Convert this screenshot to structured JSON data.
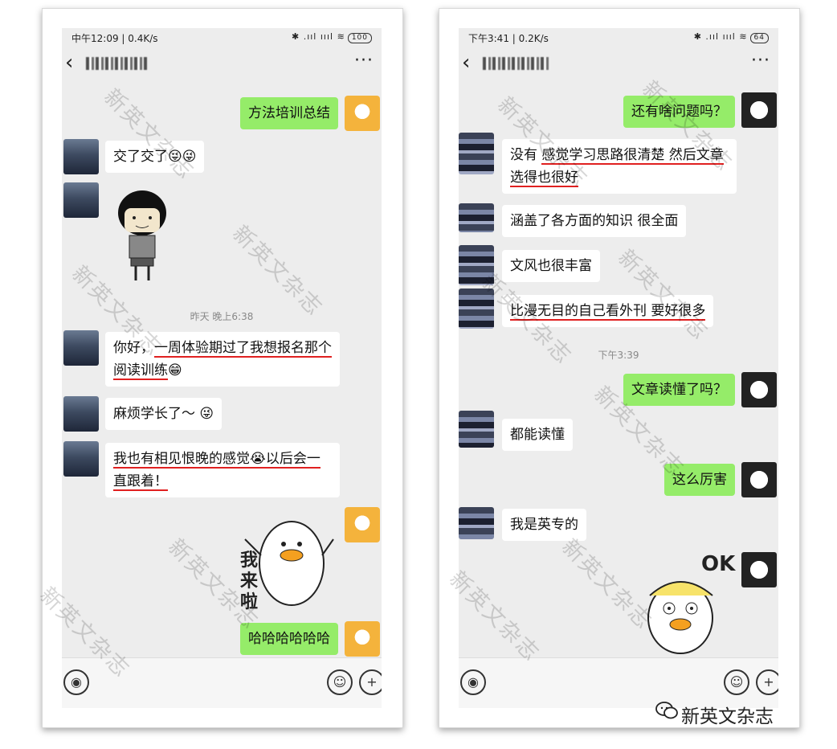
{
  "left_phone": {
    "status_time": "中午12:09 | 0.4K/s",
    "status_icons": "✱ .ııl ıııl ≋",
    "battery": "100",
    "messages": [
      {
        "side": "out",
        "text": "方法培训总结"
      },
      {
        "side": "in",
        "text": "交了交了😜😜"
      },
      {
        "side": "in",
        "sticker": "mushroom-head-sticker"
      },
      {
        "side": "in",
        "text_plain": "你好，",
        "text_ul": "一周体验期过了我想报名那个阅读训练",
        "emoji": "😁"
      },
      {
        "side": "in",
        "text": "麻烦学长了～ 😜"
      },
      {
        "side": "in",
        "text_ul": "我也有相见恨晚的感觉😭以后会一直跟着！"
      },
      {
        "side": "out",
        "sticker": "duck-sticker",
        "sticker_text": "我来啦"
      },
      {
        "side": "out",
        "text": "哈哈哈哈哈哈"
      }
    ],
    "timestamp": "昨天 晚上6:38"
  },
  "right_phone": {
    "status_time": "下午3:41 | 0.2K/s",
    "status_icons": "✱ .ııl ıııl ≋",
    "battery": "64",
    "messages": [
      {
        "side": "out",
        "text": "还有啥问题吗？"
      },
      {
        "side": "in",
        "text_plain": "没有 ",
        "text_ul": "感觉学习思路很清楚 然后文章选得也很好"
      },
      {
        "side": "in",
        "text": "涵盖了各方面的知识 很全面"
      },
      {
        "side": "in",
        "text": "文风也很丰富"
      },
      {
        "side": "in",
        "text_ul": "比漫无目的自己看外刊 要好很多"
      },
      {
        "side": "out",
        "text": "文章读懂了吗？"
      },
      {
        "side": "in",
        "text": "都能读懂"
      },
      {
        "side": "out",
        "text": "这么厉害"
      },
      {
        "side": "in",
        "text": "我是英专的"
      },
      {
        "side": "out",
        "sticker": "duck-ok-sticker",
        "sticker_text": "OK"
      }
    ],
    "timestamp": "下午3:39"
  },
  "watermark_text": "新英文杂志",
  "brand_text": "新英文杂志",
  "icons": {
    "back": "‹",
    "more": "···",
    "voice": "◉",
    "emoji": "☺",
    "plus": "+"
  }
}
